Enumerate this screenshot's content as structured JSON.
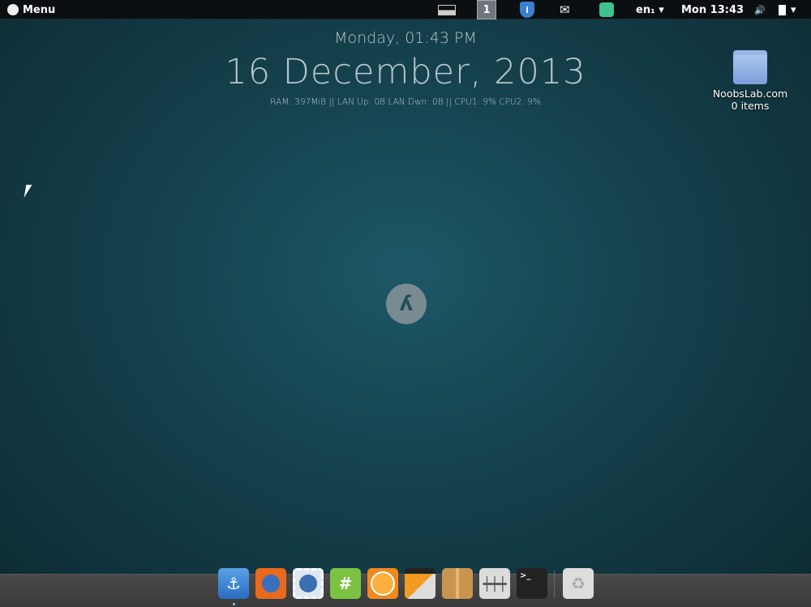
{
  "panel": {
    "menu_label": "Menu",
    "workspace": "1",
    "keyboard": "en₁ ▾",
    "clock": "Mon 13:43",
    "battery_arrow": "▾",
    "mail": "✉",
    "volume": "🔊"
  },
  "conky": {
    "day_time": "Monday, 01:43 PM",
    "date": "16 December, 2013",
    "sysinfo": "RAM: 397MiB || LAN Up: 0B  LAN Dwn: 0B  || CPU1: 9% CPU2: 9%"
  },
  "desktop": {
    "folder_name": "NoobsLab.com",
    "folder_count": "0 items"
  },
  "dock": {
    "apps": [
      "Anchor",
      "Firefox",
      "Thunderbird",
      "XChat",
      "Orange",
      "Video",
      "Archive",
      "Mixer",
      "Terminal",
      "Trash"
    ],
    "hash": "#",
    "terminal_prompt": ">_"
  }
}
